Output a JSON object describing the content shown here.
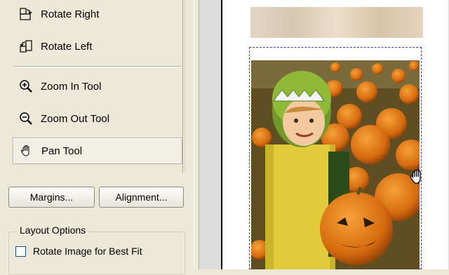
{
  "tools": [
    {
      "label": "Rotate Right",
      "icon": "rotate-right-icon"
    },
    {
      "label": "Rotate Left",
      "icon": "rotate-left-icon"
    },
    {
      "label": "Zoom In Tool",
      "icon": "zoom-in-icon"
    },
    {
      "label": "Zoom Out Tool",
      "icon": "zoom-out-icon"
    },
    {
      "label": "Pan Tool",
      "icon": "pan-hand-icon",
      "selected": true
    }
  ],
  "buttons": {
    "margins": "Margins...",
    "alignment": "Alignment..."
  },
  "layout_options": {
    "legend": "Layout Options",
    "rotate_checkbox": {
      "label": "Rotate Image for Best Fit",
      "checked": false
    }
  },
  "preview": {
    "image": "pumpkin-patch-child-photo",
    "cursor": "pan-hand-icon"
  }
}
